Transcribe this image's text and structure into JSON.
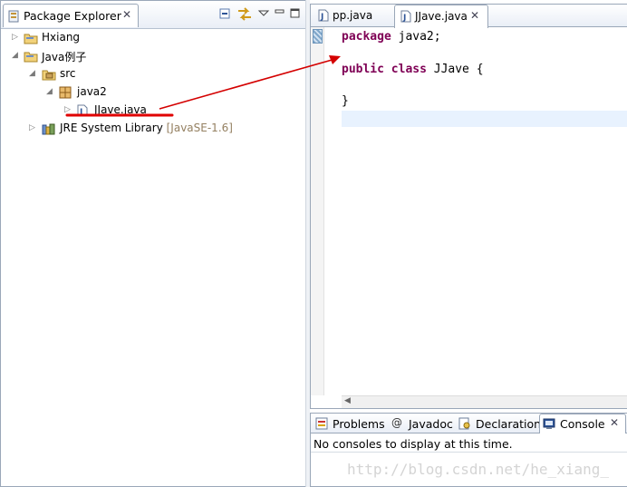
{
  "package_explorer": {
    "title": "Package Explorer",
    "tree": [
      {
        "label": "Hxiang",
        "icon": "folder-project-icon"
      },
      {
        "label": "Java例子",
        "icon": "folder-project-icon"
      },
      {
        "label": "src",
        "icon": "source-folder-icon"
      },
      {
        "label": "java2",
        "icon": "package-icon"
      },
      {
        "label": "JJave.java",
        "icon": "java-file-icon"
      },
      {
        "label": "JRE System Library",
        "decoration": "[JavaSE-1.6]",
        "icon": "library-icon"
      }
    ]
  },
  "editor": {
    "tabs": [
      {
        "label": "pp.java",
        "active": false
      },
      {
        "label": "JJave.java",
        "active": true
      }
    ],
    "code": {
      "line1_kw": "package",
      "line1_rest": " java2;",
      "line2_kw": "public class",
      "line2_rest": " JJave {",
      "line3": "}"
    }
  },
  "console": {
    "tabs": [
      "Problems",
      "Javadoc",
      "Declaration",
      "Console"
    ],
    "message": "No consoles to display at this time."
  },
  "watermark": "http://blog.csdn.net/he_xiang_",
  "colors": {
    "keyword": "#7f0055",
    "annotation_red": "#e00000",
    "decoration": "#958162",
    "current_line": "#e8f2fe"
  }
}
